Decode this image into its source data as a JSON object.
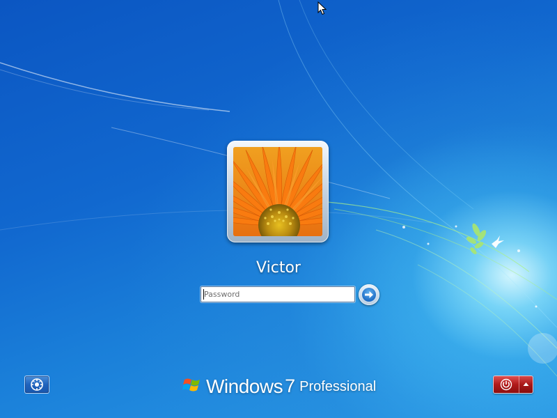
{
  "user": {
    "name": "Victor",
    "picture": "orange-gerbera-flower-picture"
  },
  "login": {
    "password_placeholder": "Password",
    "password_value": "",
    "submit_icon": "arrow-right-icon"
  },
  "branding": {
    "windows": "Windows",
    "version": "7",
    "edition": "Professional",
    "logo_icon": "windows-logo-icon"
  },
  "controls": {
    "ease_of_access_icon": "ease-of-access-icon",
    "shutdown_icon": "power-icon",
    "shutdown_options_icon": "caret-up-icon"
  },
  "colors": {
    "background_top": "#0b56c2",
    "background_bottom": "#2b9be6",
    "shutdown_red": "#b01a1a",
    "text": "#ffffff"
  }
}
